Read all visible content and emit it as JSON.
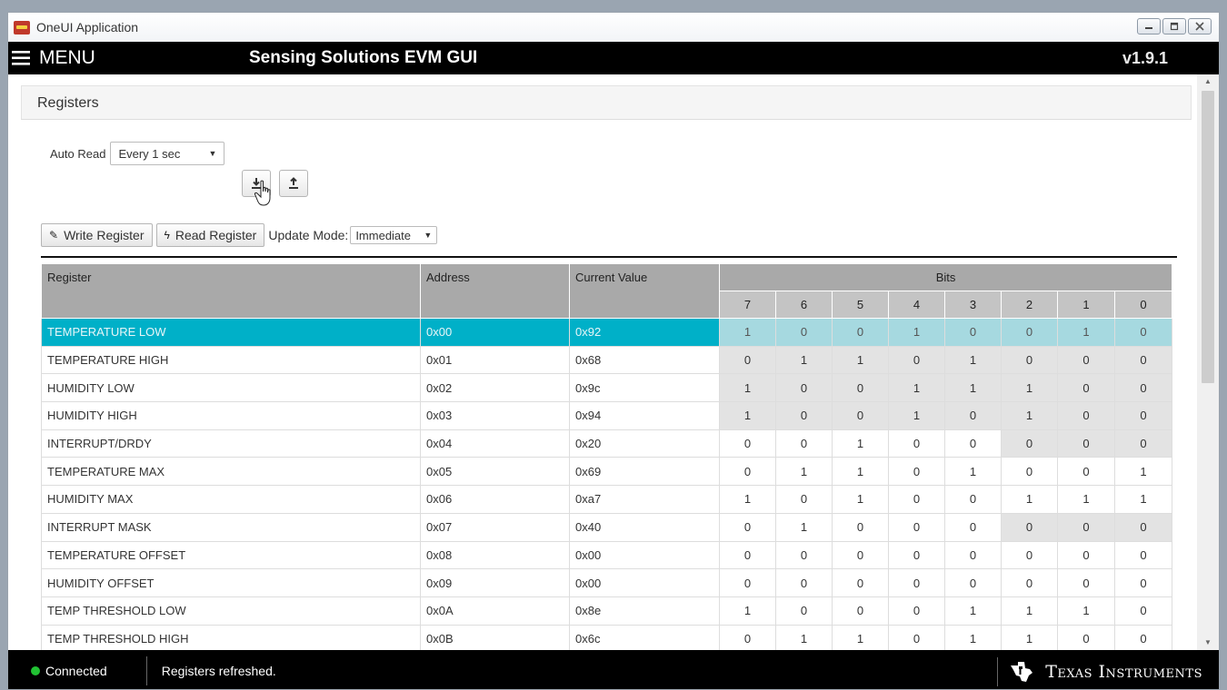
{
  "window": {
    "title": "OneUI Application"
  },
  "header": {
    "menu_label": "MENU",
    "app_title": "Sensing Solutions EVM GUI",
    "version": "v1.9.1"
  },
  "panel": {
    "title": "Registers"
  },
  "auto_read": {
    "label": "Auto Read",
    "value": "Every 1 sec"
  },
  "toolbar": {
    "write_label": "Write Register",
    "read_label": "Read Register",
    "update_mode_label": "Update Mode:",
    "update_mode_value": "Immediate"
  },
  "table": {
    "headers": {
      "register": "Register",
      "address": "Address",
      "current_value": "Current Value",
      "bits": "Bits"
    },
    "bit_numbers": [
      "7",
      "6",
      "5",
      "4",
      "3",
      "2",
      "1",
      "0"
    ],
    "rows": [
      {
        "name": "TEMPERATURE LOW",
        "address": "0x00",
        "value": "0x92",
        "bits": [
          "1",
          "0",
          "0",
          "1",
          "0",
          "0",
          "1",
          "0"
        ],
        "readonly": [
          true,
          true,
          true,
          true,
          true,
          true,
          true,
          true
        ],
        "selected": true
      },
      {
        "name": "TEMPERATURE HIGH",
        "address": "0x01",
        "value": "0x68",
        "bits": [
          "0",
          "1",
          "1",
          "0",
          "1",
          "0",
          "0",
          "0"
        ],
        "readonly": [
          true,
          true,
          true,
          true,
          true,
          true,
          true,
          true
        ],
        "selected": false
      },
      {
        "name": "HUMIDITY LOW",
        "address": "0x02",
        "value": "0x9c",
        "bits": [
          "1",
          "0",
          "0",
          "1",
          "1",
          "1",
          "0",
          "0"
        ],
        "readonly": [
          true,
          true,
          true,
          true,
          true,
          true,
          true,
          true
        ],
        "selected": false
      },
      {
        "name": "HUMIDITY HIGH",
        "address": "0x03",
        "value": "0x94",
        "bits": [
          "1",
          "0",
          "0",
          "1",
          "0",
          "1",
          "0",
          "0"
        ],
        "readonly": [
          true,
          true,
          true,
          true,
          true,
          true,
          true,
          true
        ],
        "selected": false
      },
      {
        "name": "INTERRUPT/DRDY",
        "address": "0x04",
        "value": "0x20",
        "bits": [
          "0",
          "0",
          "1",
          "0",
          "0",
          "0",
          "0",
          "0"
        ],
        "readonly": [
          false,
          false,
          false,
          false,
          false,
          true,
          true,
          true
        ],
        "selected": false
      },
      {
        "name": "TEMPERATURE MAX",
        "address": "0x05",
        "value": "0x69",
        "bits": [
          "0",
          "1",
          "1",
          "0",
          "1",
          "0",
          "0",
          "1"
        ],
        "readonly": [
          false,
          false,
          false,
          false,
          false,
          false,
          false,
          false
        ],
        "selected": false
      },
      {
        "name": "HUMIDITY MAX",
        "address": "0x06",
        "value": "0xa7",
        "bits": [
          "1",
          "0",
          "1",
          "0",
          "0",
          "1",
          "1",
          "1"
        ],
        "readonly": [
          false,
          false,
          false,
          false,
          false,
          false,
          false,
          false
        ],
        "selected": false
      },
      {
        "name": "INTERRUPT MASK",
        "address": "0x07",
        "value": "0x40",
        "bits": [
          "0",
          "1",
          "0",
          "0",
          "0",
          "0",
          "0",
          "0"
        ],
        "readonly": [
          false,
          false,
          false,
          false,
          false,
          true,
          true,
          true
        ],
        "selected": false
      },
      {
        "name": "TEMPERATURE OFFSET",
        "address": "0x08",
        "value": "0x00",
        "bits": [
          "0",
          "0",
          "0",
          "0",
          "0",
          "0",
          "0",
          "0"
        ],
        "readonly": [
          false,
          false,
          false,
          false,
          false,
          false,
          false,
          false
        ],
        "selected": false
      },
      {
        "name": "HUMIDITY OFFSET",
        "address": "0x09",
        "value": "0x00",
        "bits": [
          "0",
          "0",
          "0",
          "0",
          "0",
          "0",
          "0",
          "0"
        ],
        "readonly": [
          false,
          false,
          false,
          false,
          false,
          false,
          false,
          false
        ],
        "selected": false
      },
      {
        "name": "TEMP THRESHOLD LOW",
        "address": "0x0A",
        "value": "0x8e",
        "bits": [
          "1",
          "0",
          "0",
          "0",
          "1",
          "1",
          "1",
          "0"
        ],
        "readonly": [
          false,
          false,
          false,
          false,
          false,
          false,
          false,
          false
        ],
        "selected": false
      },
      {
        "name": "TEMP THRESHOLD HIGH",
        "address": "0x0B",
        "value": "0x6c",
        "bits": [
          "0",
          "1",
          "1",
          "0",
          "1",
          "1",
          "0",
          "0"
        ],
        "readonly": [
          false,
          false,
          false,
          false,
          false,
          false,
          false,
          false
        ],
        "selected": false
      }
    ]
  },
  "status": {
    "connection": "Connected",
    "message": "Registers refreshed."
  },
  "branding": {
    "company": "Texas Instruments"
  },
  "colors": {
    "selected_row": "#00b0c8",
    "selected_bits": "#a6d9e0",
    "header_bg": "#a9a9a9",
    "connected": "#21c233"
  }
}
